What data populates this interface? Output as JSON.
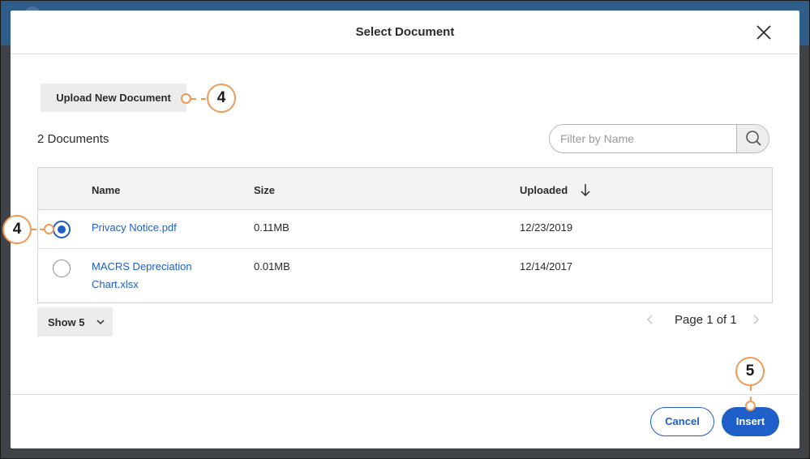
{
  "dialog": {
    "title": "Select Document",
    "upload_button": "Upload New Document",
    "doc_count": "2 Documents",
    "filter_placeholder": "Filter by Name"
  },
  "table": {
    "headers": {
      "name": "Name",
      "size": "Size",
      "uploaded": "Uploaded"
    },
    "sort": {
      "column": "Uploaded",
      "direction": "descending"
    },
    "rows": [
      {
        "name_line1": "Privacy Notice.pdf",
        "name_line2": "",
        "size": "0.11MB",
        "uploaded": "12/23/2019",
        "selected": true
      },
      {
        "name_line1": "MACRS Depreciation",
        "name_line2": "Chart.xlsx",
        "size": "0.01MB",
        "uploaded": "12/14/2017",
        "selected": false
      }
    ]
  },
  "pagination": {
    "show_label": "Show 5",
    "page_text": "Page 1 of 1"
  },
  "footer": {
    "cancel_label": "Cancel",
    "insert_label": "Insert"
  },
  "callouts": {
    "upload": "4",
    "radio": "4",
    "insert": "5"
  },
  "colors": {
    "accent": "#1f5fc9",
    "callout": "#f19a56",
    "backdrop": "#3f4347"
  }
}
